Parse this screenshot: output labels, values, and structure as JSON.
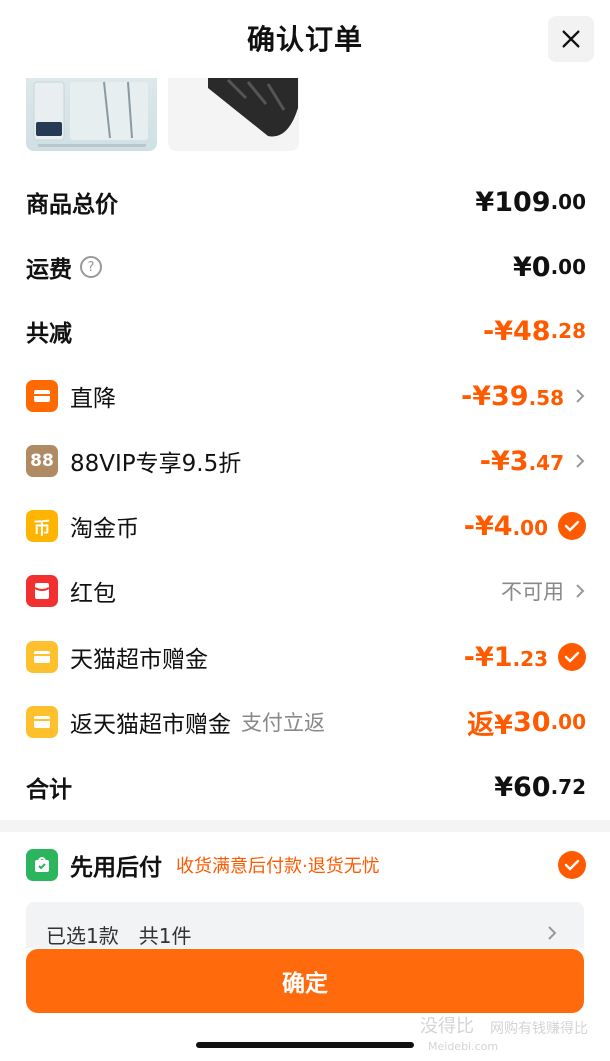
{
  "header": {
    "title": "确认订单"
  },
  "summary": {
    "goods_total": {
      "label": "商品总价",
      "currency": "¥",
      "int": "109",
      "dec": ".00"
    },
    "shipping": {
      "label": "运费",
      "help": "?",
      "currency": "¥",
      "int": "0",
      "dec": ".00"
    },
    "reduction": {
      "label": "共减",
      "prefix": "-¥",
      "int": "48",
      "dec": ".28"
    }
  },
  "discounts": [
    {
      "label": "直降",
      "prefix": "-¥",
      "int": "39",
      "dec": ".58",
      "icon": "direct-discount-icon",
      "color": "#ff6a00"
    },
    {
      "label": "88VIP专享9.5折",
      "prefix": "-¥",
      "int": "3",
      "dec": ".47",
      "icon": "88vip-icon",
      "icon_text": "88",
      "color": "#a07c56"
    },
    {
      "label": "淘金币",
      "prefix": "-¥",
      "int": "4",
      "dec": ".00",
      "icon": "taojinbi-coin-icon",
      "icon_text": "币",
      "color": "#ffb400"
    },
    {
      "label": "红包",
      "status": "不可用",
      "icon": "red-packet-icon",
      "color": "#f23030"
    },
    {
      "label": "天猫超市赠金",
      "prefix": "-¥",
      "int": "1",
      "dec": ".23",
      "icon": "tmall-gift-icon",
      "color": "#ffc02e"
    },
    {
      "label": "返天猫超市赠金",
      "note": "支付立返",
      "prefix": "返¥",
      "int": "30",
      "dec": ".00",
      "icon": "tmall-rebate-icon",
      "color": "#ffc02e"
    }
  ],
  "total": {
    "label": "合计",
    "currency": "¥",
    "int": "60",
    "dec": ".72"
  },
  "pay_later": {
    "title": "先用后付",
    "desc": "收货满意后付款·退货无忧",
    "icon": "pay-later-icon",
    "color": "#2bb55d"
  },
  "selection": {
    "text": "已选1款　共1件"
  },
  "confirm_button": {
    "label": "确定"
  },
  "watermark": {
    "site": "没得比",
    "slogan": "网购有钱赚得比",
    "domain": "Meidebi.com"
  },
  "accent_color": "#ff5a00"
}
